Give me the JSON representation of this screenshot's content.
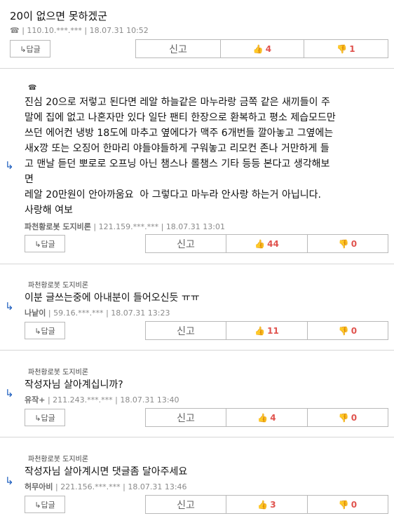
{
  "comments": [
    {
      "quote": "",
      "body": "20이 없으면 못하겠군",
      "nick": "",
      "phone_icon": "☎",
      "ip": "110.10.***.***",
      "date": "18.07.31 10:52",
      "reply_label": "↳답글",
      "report_label": "신고",
      "up": "4",
      "down": "1"
    },
    {
      "quote": "☎",
      "body": "진심 20으로 저렇고 된다면 레알 하늘같은 마누라랑 금쪽 같은 새끼들이 주\n말에 집에 없고 나혼자만 있다 일단 팬티 한장으로 환복하고 평소 제습모드만\n쓰던 에어컨 냉방 18도에 마추고 옆에다가 맥주 6개번들 깔아놓고 그옆에는\n새x깡 또는 오징어 한마리 야들야들하게 구워놓고 리모컨 존나 거만하게 들\n고 맨날 듣던 뽀로로 오프닝 아닌 챔스나 롤챔스 기타 등등 본다고 생각해보\n면\n레알 20만원이 안아까움요  아 그렇다고 마누라 안사랑 하는거 아닙니다.\n사랑해 여보",
      "nick": "파천황로봇 도지비론",
      "ip": "121.159.***.***",
      "date": "18.07.31 13:01",
      "reply_label": "↳답글",
      "report_label": "신고",
      "up": "44",
      "down": "0"
    },
    {
      "quote": "파천황로봇 도지비론",
      "body": "이분 글쓰는중에 아내분이 들어오신듯 ㅠㅠ",
      "nick": "나낱이",
      "ip": "59.16.***.***",
      "date": "18.07.31 13:23",
      "reply_label": "↳답글",
      "report_label": "신고",
      "up": "11",
      "down": "0"
    },
    {
      "quote": "파천황로봇 도지비론",
      "body": "작성자님 살아계십니까?",
      "nick": "유작+",
      "ip": "211.243.***.***",
      "date": "18.07.31 13:40",
      "reply_label": "↳답글",
      "report_label": "신고",
      "up": "4",
      "down": "0"
    },
    {
      "quote": "파천황로봇 도지비론",
      "body": "작성자님 살아계시면 댓글좀 달아주세요",
      "nick": "허무아비",
      "ip": "221.156.***.***",
      "date": "18.07.31 13:46",
      "reply_label": "↳답글",
      "report_label": "신고",
      "up": "3",
      "down": "0"
    }
  ],
  "icons": {
    "reply_arrow": "↳",
    "thumb_up": "👍",
    "thumb_down": "👎"
  }
}
